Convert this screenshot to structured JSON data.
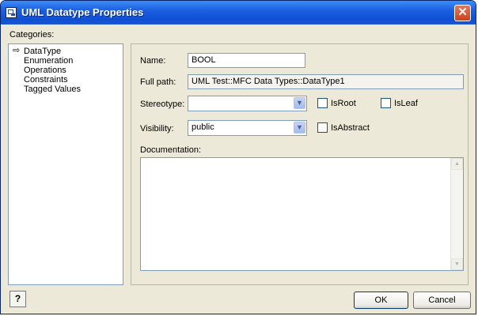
{
  "window": {
    "title": "UML Datatype Properties",
    "close_glyph": "✕"
  },
  "categories": {
    "label": "Categories:",
    "selected_marker": "⇨",
    "items": [
      "DataType",
      "Enumeration",
      "Operations",
      "Constraints",
      "Tagged Values"
    ]
  },
  "form": {
    "name_label": "Name:",
    "name_value": "BOOL",
    "fullpath_label": "Full path:",
    "fullpath_value": "UML Test::MFC Data Types::DataType1",
    "stereotype_label": "Stereotype:",
    "stereotype_value": "",
    "visibility_label": "Visibility:",
    "visibility_value": "public",
    "isroot_label": "IsRoot",
    "isroot_checked": false,
    "isleaf_label": "IsLeaf",
    "isleaf_checked": false,
    "isabstract_label": "IsAbstract",
    "isabstract_checked": false,
    "documentation_label": "Documentation:",
    "documentation_value": ""
  },
  "buttons": {
    "ok": "OK",
    "cancel": "Cancel",
    "help": "?"
  },
  "icons": {
    "dropdown": "▼",
    "scroll_up": "▲",
    "scroll_down": "▼"
  }
}
